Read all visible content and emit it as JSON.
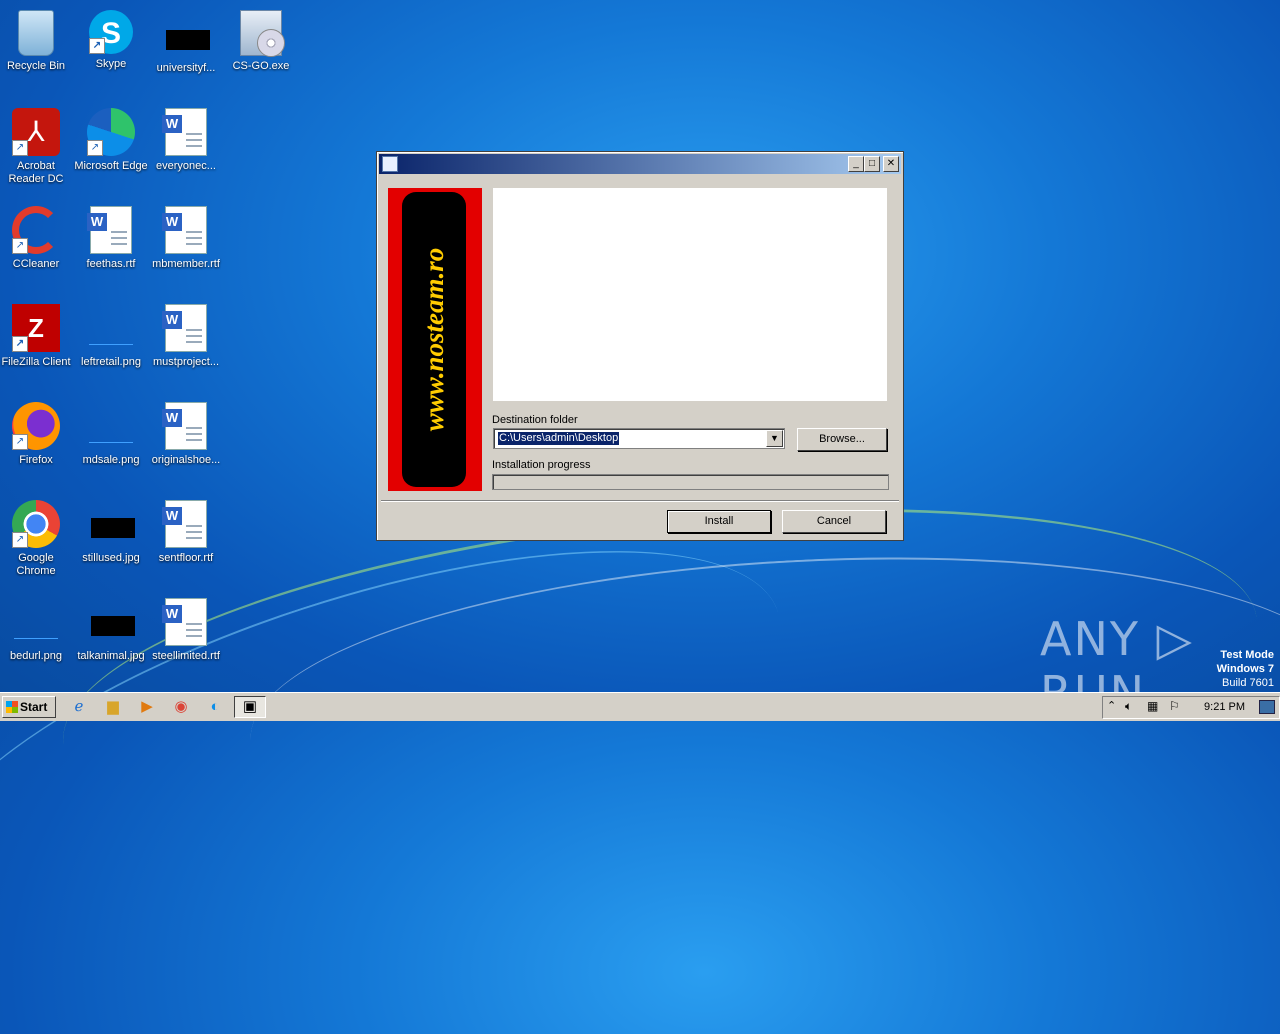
{
  "desktop_icons": {
    "recycle_bin": "Recycle Bin",
    "skype": "Skype",
    "universityf": "universityf...",
    "csgo": "CS-GO.exe",
    "acrobat": "Acrobat Reader DC",
    "edge": "Microsoft Edge",
    "everyonec": "everyonec...",
    "ccleaner": "CCleaner",
    "feethas": "feethas.rtf",
    "mbmember": "mbmember.rtf",
    "filezilla": "FileZilla Client",
    "leftretail": "leftretail.png",
    "mustproject": "mustproject...",
    "firefox": "Firefox",
    "mdsale": "mdsale.png",
    "originalshoe": "originalshoe...",
    "chrome": "Google Chrome",
    "stillused": "stillused.jpg",
    "sentfloor": "sentfloor.rtf",
    "bedurl": "bedurl.png",
    "talkanimal": "talkanimal.jpg",
    "steellimited": "steellimited.rtf"
  },
  "dialog": {
    "banner_text": "www.nosteam.ro",
    "destination_label": "Destination folder",
    "destination_value": "C:\\Users\\admin\\Desktop",
    "browse_label": "Browse...",
    "progress_label": "Installation progress",
    "progress_value": 0,
    "install_label": "Install",
    "cancel_label": "Cancel"
  },
  "watermark": {
    "brand": "ANY ▷ RUN",
    "test_mode": "Test Mode",
    "os": "Windows 7",
    "build": "Build 7601"
  },
  "taskbar": {
    "start_label": "Start",
    "clock": "9:21 PM"
  }
}
